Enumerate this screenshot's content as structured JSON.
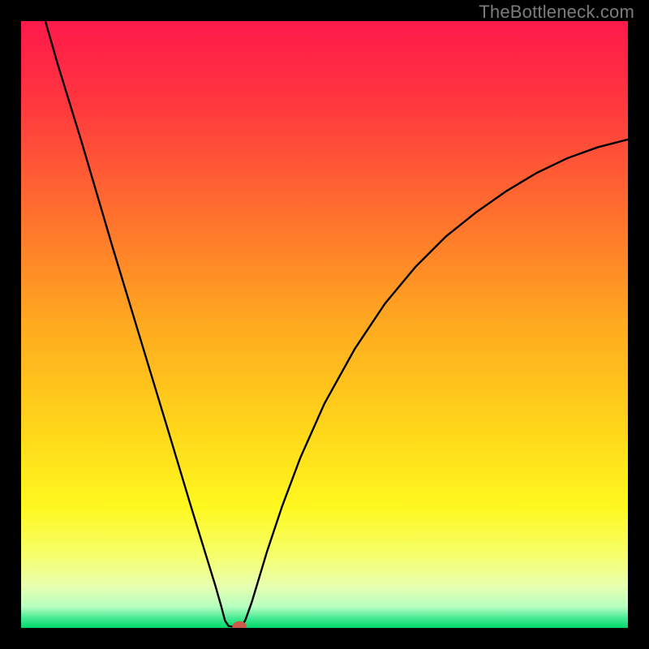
{
  "watermark": "TheBottleneck.com",
  "chart_data": {
    "type": "line",
    "title": "",
    "xlabel": "",
    "ylabel": "",
    "xlim": [
      0,
      100
    ],
    "ylim": [
      0,
      100
    ],
    "background_gradient": {
      "stops": [
        {
          "offset": 0.0,
          "color": "#ff1a4b"
        },
        {
          "offset": 0.12,
          "color": "#ff3340"
        },
        {
          "offset": 0.3,
          "color": "#ff6a2f"
        },
        {
          "offset": 0.5,
          "color": "#ffaa1f"
        },
        {
          "offset": 0.68,
          "color": "#ffd81a"
        },
        {
          "offset": 0.8,
          "color": "#fff81f"
        },
        {
          "offset": 0.88,
          "color": "#f6ff6a"
        },
        {
          "offset": 0.93,
          "color": "#e8ffb0"
        },
        {
          "offset": 0.965,
          "color": "#b8ffc0"
        },
        {
          "offset": 0.985,
          "color": "#40e890"
        },
        {
          "offset": 1.0,
          "color": "#00d86a"
        }
      ]
    },
    "series": [
      {
        "name": "curve",
        "color": "#000000",
        "width": 2.4,
        "points": [
          {
            "x": 4.0,
            "y": 100.0
          },
          {
            "x": 6.0,
            "y": 93.0
          },
          {
            "x": 10.0,
            "y": 80.0
          },
          {
            "x": 15.0,
            "y": 63.0
          },
          {
            "x": 20.0,
            "y": 46.5
          },
          {
            "x": 25.0,
            "y": 30.0
          },
          {
            "x": 28.0,
            "y": 20.0
          },
          {
            "x": 30.0,
            "y": 13.5
          },
          {
            "x": 32.0,
            "y": 7.0
          },
          {
            "x": 33.0,
            "y": 3.5
          },
          {
            "x": 33.6,
            "y": 1.2
          },
          {
            "x": 34.2,
            "y": 0.3
          },
          {
            "x": 35.0,
            "y": 0.2
          },
          {
            "x": 35.8,
            "y": 0.2
          },
          {
            "x": 36.4,
            "y": 0.3
          },
          {
            "x": 37.0,
            "y": 1.4
          },
          {
            "x": 38.0,
            "y": 4.2
          },
          {
            "x": 39.0,
            "y": 7.5
          },
          {
            "x": 40.5,
            "y": 12.5
          },
          {
            "x": 43.0,
            "y": 20.0
          },
          {
            "x": 46.0,
            "y": 28.0
          },
          {
            "x": 50.0,
            "y": 37.0
          },
          {
            "x": 55.0,
            "y": 46.0
          },
          {
            "x": 60.0,
            "y": 53.5
          },
          {
            "x": 65.0,
            "y": 59.5
          },
          {
            "x": 70.0,
            "y": 64.5
          },
          {
            "x": 75.0,
            "y": 68.5
          },
          {
            "x": 80.0,
            "y": 72.0
          },
          {
            "x": 85.0,
            "y": 75.0
          },
          {
            "x": 90.0,
            "y": 77.4
          },
          {
            "x": 95.0,
            "y": 79.2
          },
          {
            "x": 100.0,
            "y": 80.5
          }
        ]
      }
    ],
    "marker": {
      "x": 36.0,
      "y": 0.2,
      "rx": 1.2,
      "ry": 0.9,
      "color": "#cc5a4a"
    }
  }
}
